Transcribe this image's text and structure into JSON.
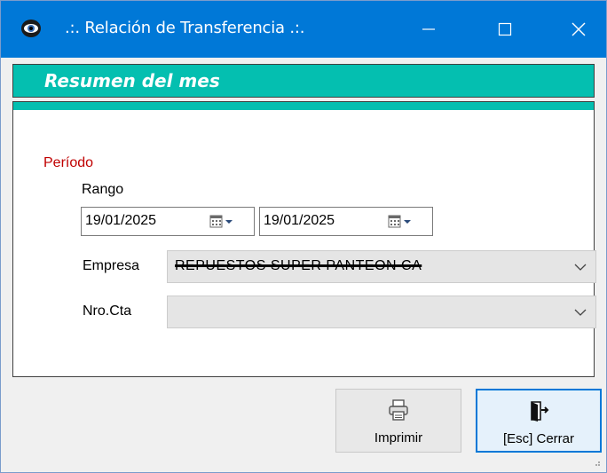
{
  "window": {
    "title": ".:. Relación de Transferencia .:.",
    "accent_color": "#0078d7",
    "header_color": "#04bfb0",
    "controls": [
      "minimize-icon",
      "maximize-icon",
      "close-icon"
    ]
  },
  "header": {
    "title": "Resumen del mes"
  },
  "form": {
    "period_label": "Período",
    "range_label": "Rango",
    "date_from": "19/01/2025",
    "date_to": "19/01/2025",
    "company_label": "Empresa",
    "company_value": "REPUESTOS SUPER PANTEON CA",
    "account_label": "Nro.Cta",
    "account_value": ""
  },
  "buttons": {
    "print_label": "Imprimir",
    "close_label": "[Esc] Cerrar"
  },
  "icons": {
    "app": "eye-icon",
    "calendar": "calendar-icon",
    "print": "printer-icon",
    "exit": "exit-door-icon",
    "dropdown": "chevron-down-icon"
  }
}
